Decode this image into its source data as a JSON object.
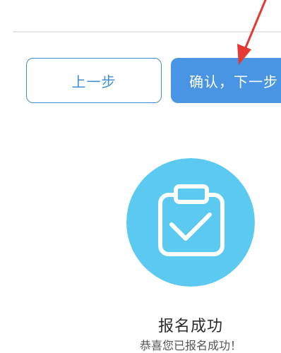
{
  "buttons": {
    "prev_label": "上一步",
    "next_label": "确认，下一步"
  },
  "result": {
    "icon": "clipboard-check-icon",
    "title": "报名成功",
    "subtitle": "恭喜您已报名成功！"
  },
  "annotation": {
    "icon": "red-arrow-icon"
  },
  "colors": {
    "primary": "#4a95e3",
    "outline": "#3f8fd6",
    "success_circle": "#5ccaf0",
    "arrow": "#e53935"
  }
}
